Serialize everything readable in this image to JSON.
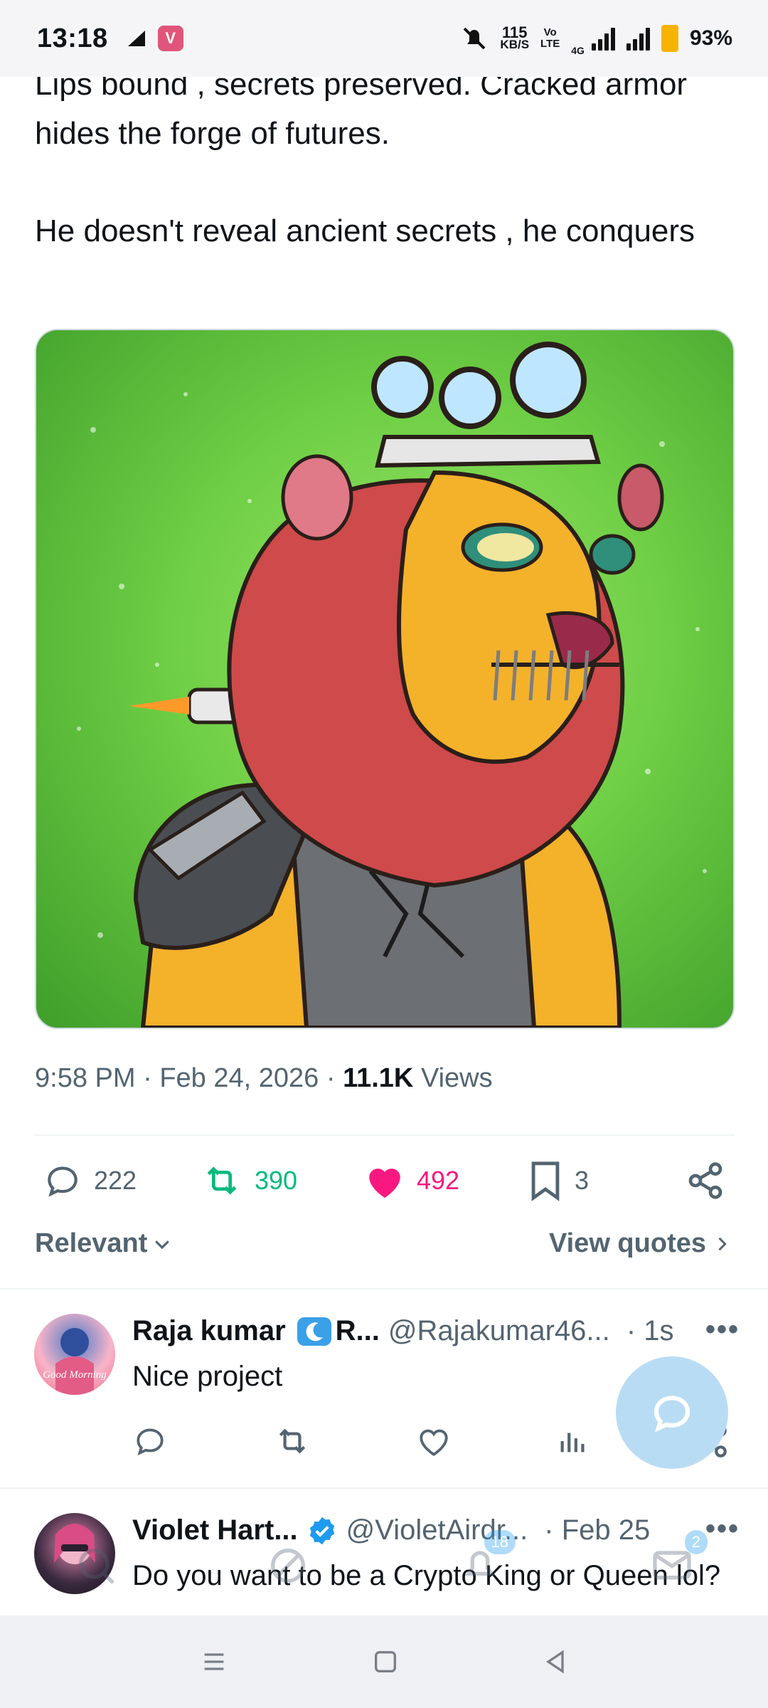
{
  "status_bar": {
    "time": "13:18",
    "app_badge": "V",
    "net_speed_value": "115",
    "net_speed_unit": "KB/S",
    "volte_1": "Vo",
    "volte_2": "LTE",
    "network_type": "4G",
    "battery": "93%"
  },
  "tweet": {
    "text_line_1": "Lips bound , secrets preserved. Cracked armor hides the forge of futures.",
    "text_line_2": "He doesn't reveal ancient secrets , he conquers",
    "time": "9:58 PM",
    "date": "Feb 24, 2026",
    "views_count": "11.1K",
    "views_label": "Views",
    "stats": {
      "replies": "222",
      "reposts": "390",
      "likes": "492",
      "bookmarks": "3"
    }
  },
  "sort": {
    "label": "Relevant",
    "view_quotes": "View quotes"
  },
  "replies": [
    {
      "name": "Raja kumar",
      "name_suffix": "R...",
      "handle": "@Rajakumar46...",
      "time": "1s",
      "text": "Nice project",
      "avatar_text": "Good Morning"
    },
    {
      "name": "Violet Hart...",
      "handle": "@VioletAirdr...",
      "time": "Feb 25",
      "text": "Do you want to be a Crypto King or Queen lol?"
    }
  ],
  "tabbar": {
    "notifications_badge": "18",
    "messages_badge": "2"
  },
  "colors": {
    "repost": "#00ba7c",
    "like": "#f91880",
    "secondary_text": "#536471",
    "verified": "#1d9bf0",
    "fab": "#b9dcf5"
  },
  "icons": [
    "reply-icon",
    "repost-icon",
    "heart-icon",
    "bookmark-icon",
    "share-icon",
    "analytics-icon",
    "compose-icon",
    "more-icon",
    "verified-icon",
    "chevron-down-icon",
    "chevron-right-icon"
  ]
}
